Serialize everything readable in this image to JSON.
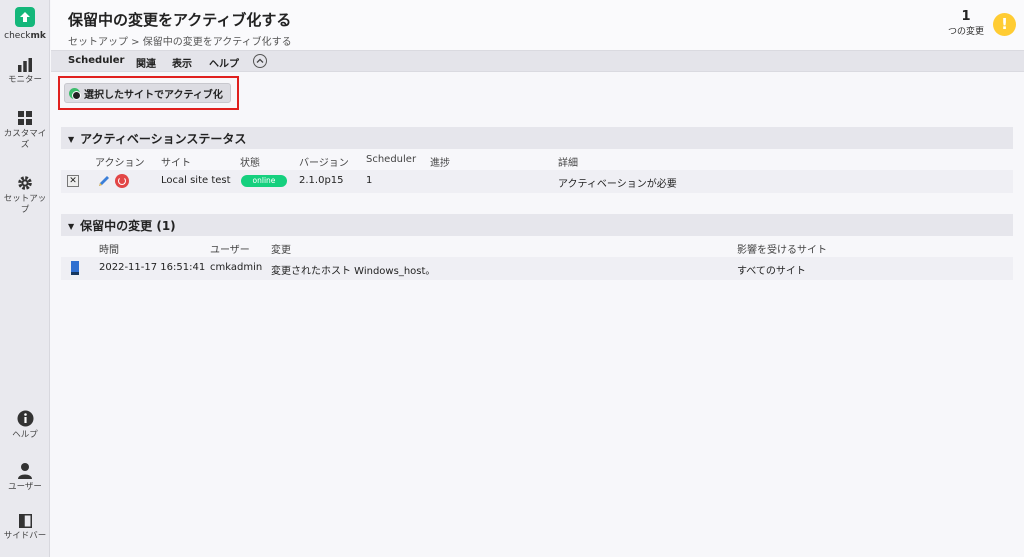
{
  "sidebar": {
    "brand_a": "check",
    "brand_b": "mk",
    "items": [
      {
        "label": "モニター",
        "icon": "bar-chart-icon"
      },
      {
        "label": "カスタマイズ",
        "icon": "grid-icon"
      },
      {
        "label": "セットアップ",
        "icon": "gear-icon"
      },
      {
        "label": "ヘルプ",
        "icon": "info-icon"
      },
      {
        "label": "ユーザー",
        "icon": "user-icon"
      },
      {
        "label": "サイドバー",
        "icon": "sidebar-icon"
      }
    ]
  },
  "header": {
    "title": "保留中の変更をアクティブ化する",
    "breadcrumb": "セットアップ > 保留中の変更をアクティブ化する",
    "changes_count": "1",
    "changes_label": "つの変更",
    "warn_symbol": "!"
  },
  "menu": {
    "items": [
      "Scheduler",
      "関連",
      "表示",
      "ヘルプ"
    ]
  },
  "activate_button": {
    "label": "選択したサイトでアクティブ化"
  },
  "activation_status": {
    "title": "アクティベーションステータス",
    "columns": [
      "アクション",
      "サイト",
      "状態",
      "バージョン",
      "Scheduler",
      "進捗",
      "詳細"
    ],
    "row": {
      "checkbox": "✕",
      "site": "Local site test",
      "state": "online",
      "version": "2.1.0p15",
      "scheduler": "1",
      "progress": "",
      "detail": "アクティベーションが必要"
    }
  },
  "pending_changes": {
    "title": "保留中の変更 (1)",
    "columns": [
      "時間",
      "ユーザー",
      "変更",
      "影響を受けるサイト"
    ],
    "row": {
      "time": "2022-11-17 16:51:41",
      "user": "cmkadmin",
      "change": "変更されたホスト Windows_host。",
      "sites": "すべてのサイト"
    }
  },
  "colors": {
    "brand_green": "#14b77a",
    "online_green": "#15d07e",
    "highlight_red": "#e0201e",
    "warn_yellow": "#ffcc33"
  }
}
